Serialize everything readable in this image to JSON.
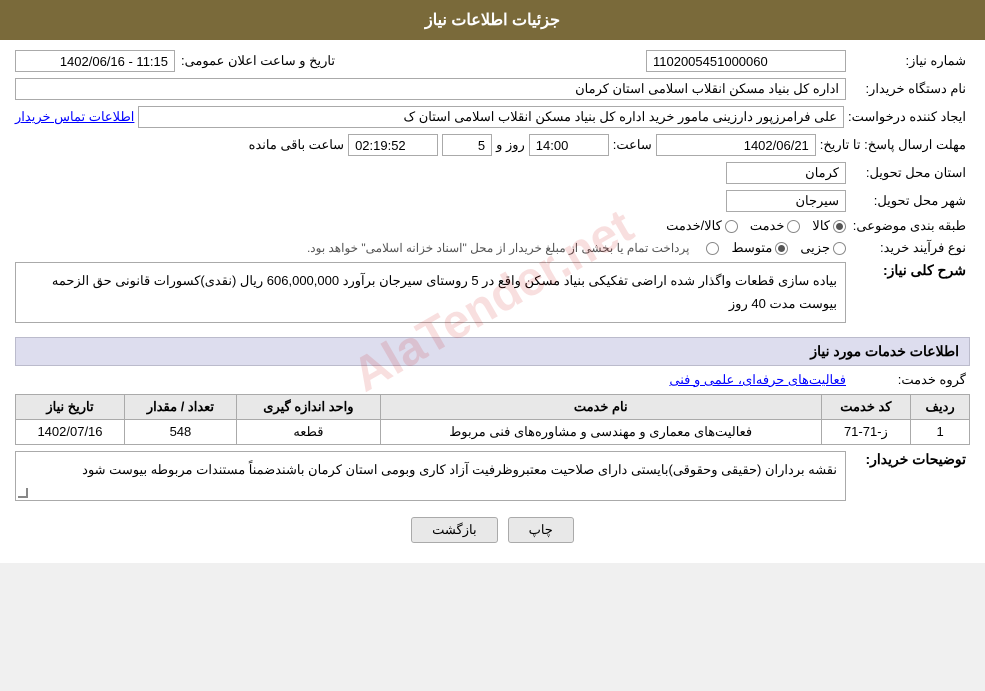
{
  "header": {
    "title": "جزئیات اطلاعات نیاز"
  },
  "form": {
    "need_number_label": "شماره نیاز:",
    "need_number_value": "1102005451000060",
    "buyer_org_label": "نام دستگاه خریدار:",
    "buyer_org_value": "اداره کل بنیاد مسکن انقلاب اسلامی استان کرمان",
    "creator_label": "ایجاد کننده درخواست:",
    "creator_value": "علی فرامرزپور دارزینی مامور خرید اداره کل بنیاد مسکن انقلاب اسلامی استان ک",
    "contact_link": "اطلاعات تماس خریدار",
    "deadline_label": "مهلت ارسال پاسخ: تا تاریخ:",
    "deadline_date": "1402/06/21",
    "deadline_time_label": "ساعت:",
    "deadline_time": "14:00",
    "deadline_days_label": "روز و",
    "deadline_days": "5",
    "deadline_remaining_label": "ساعت باقی مانده",
    "deadline_remaining": "02:19:52",
    "province_label": "استان محل تحویل:",
    "province_value": "کرمان",
    "city_label": "شهر محل تحویل:",
    "city_value": "سیرجان",
    "type_label": "طبقه بندی موضوعی:",
    "type_options": [
      "کالا",
      "خدمت",
      "کالا/خدمت"
    ],
    "type_selected": "کالا",
    "process_label": "نوع فرآیند خرید:",
    "process_options": [
      "جزیی",
      "متوسط",
      ""
    ],
    "process_selected": "متوسط",
    "process_note": "پرداخت تمام یا بخشی از مبلغ خریدار از محل \"اسناد خزانه اسلامی\" خواهد بود.",
    "announce_datetime_label": "تاریخ و ساعت اعلان عمومی:",
    "announce_datetime_value": "1402/06/16 - 11:15",
    "description_section_title": "شرح کلی نیاز:",
    "description_text": "بیاده سازی قطعات واگذار شده اراضی تفکیکی بنیاد مسکن واقع در 5 روستای سیرجان  برآورد 606,000,000 ریال (نقدی)کسورات قانونی حق الزحمه بیوست مدت 40 روز",
    "services_section_title": "اطلاعات خدمات مورد نیاز",
    "service_group_label": "گروه خدمت:",
    "service_group_value": "فعالیت‌های حرفه‌ای، علمی و فنی",
    "table": {
      "headers": [
        "ردیف",
        "کد خدمت",
        "نام خدمت",
        "واحد اندازه گیری",
        "تعداد / مقدار",
        "تاریخ نیاز"
      ],
      "rows": [
        {
          "row": "1",
          "code": "ز-71-71",
          "name": "فعالیت‌های معماری و مهندسی و مشاوره‌های فنی مربوط",
          "unit": "قطعه",
          "qty": "548",
          "date": "1402/07/16"
        }
      ]
    },
    "buyer_comments_label": "توضیحات خریدار:",
    "buyer_comments_text": "نقشه برداران (حقیقی وحقوقی)بایستی دارای صلاحیت معتبروظرفیت آزاد کاری وبومی استان کرمان باشندضمناً مستندات مربوطه بیوست شود",
    "back_button": "بازگشت",
    "print_button": "چاپ"
  }
}
